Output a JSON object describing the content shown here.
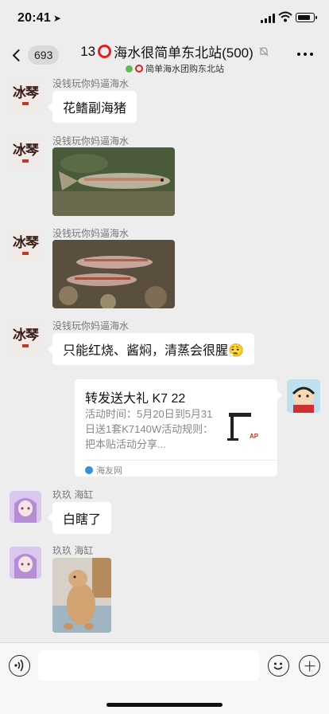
{
  "status": {
    "time": "20:41",
    "location_arrow": "location-arrow-icon",
    "battery_level": 0.85
  },
  "header": {
    "unread_count": "693",
    "title_prefix": "13",
    "title_suffix": "海水很简单东北站(500)",
    "subtitle": "简单海水团购东北站",
    "muted_icon": "bell-muted-icon",
    "more_icon": "more-icon"
  },
  "messages": [
    {
      "sender": "没钱玩你妈逼海水",
      "type": "text",
      "text": "花鳍副海猪"
    },
    {
      "sender": "没钱玩你妈逼海水",
      "type": "image",
      "description_icon": "fish-photo"
    },
    {
      "sender": "没钱玩你妈逼海水",
      "type": "image",
      "description_icon": "fish-photo"
    },
    {
      "sender": "没钱玩你妈逼海水",
      "type": "text",
      "text": "只能红烧、酱焖，清蒸会很腥😮‍💨"
    },
    {
      "type": "link",
      "title": "转发送大礼 K7 22",
      "description": "活动时间：5月20日到5月31日送1套K7140W活动规则：把本贴活动分享...",
      "source": "海友网"
    },
    {
      "sender": "玖玖 海缸",
      "type": "text",
      "text": "白瞎了"
    },
    {
      "sender": "玖玖 海缸",
      "type": "image",
      "description_icon": "dog-photo"
    }
  ],
  "avatars": {
    "calligraphy_text": "冰琴",
    "self": "crayon-shin-chan-avatar",
    "anime": "anime-girl-avatar"
  },
  "input": {
    "placeholder": ""
  },
  "colors": {
    "background": "#ededed",
    "bubble": "#ffffff",
    "ring": "#e02020"
  }
}
